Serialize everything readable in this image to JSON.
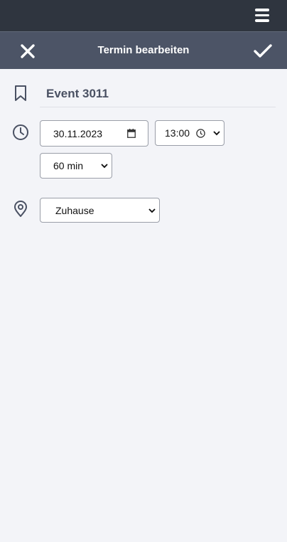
{
  "header": {
    "title": "Termin bearbeiten"
  },
  "event": {
    "title": "Event 3011"
  },
  "form": {
    "date": "30.11.2023",
    "time": "13:00",
    "duration": "60 min",
    "location": "Zuhause"
  },
  "icons": {
    "menu": "hamburger-icon",
    "close": "close-icon",
    "confirm": "checkmark-icon",
    "title": "bookmark-icon",
    "time": "clock-icon",
    "location": "location-pin-icon",
    "calendar": "calendar-icon",
    "time_picker": "clock-icon",
    "dropdown": "chevron-down-icon"
  },
  "colors": {
    "topbar": "#2f353f",
    "header": "#4c5466",
    "background": "#f3f4f8",
    "icon": "#4a5163"
  }
}
